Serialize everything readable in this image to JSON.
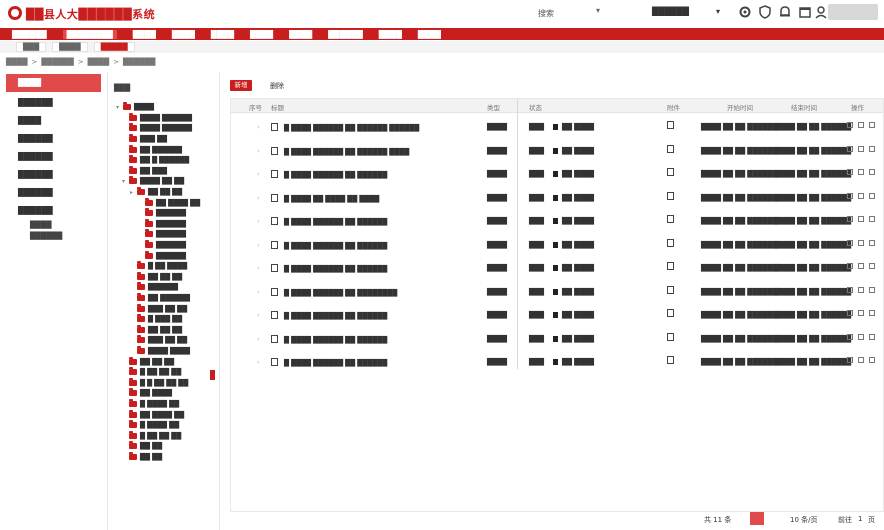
{
  "app": {
    "title": "██县人大██████系统",
    "search_label": "搜索",
    "user_name": "██████",
    "colors": {
      "brand": "#c81e1e",
      "brand_light": "#e04a4a",
      "header_bg": "#f2f2f2"
    },
    "toolbar_icons": [
      "gear-icon",
      "shield-icon",
      "bell-icon",
      "window-icon",
      "user-icon"
    ]
  },
  "nav": {
    "items": [
      "██████",
      "████████",
      "████",
      "████",
      "████",
      "████",
      "████",
      "██████",
      "████",
      "████"
    ]
  },
  "tabs": {
    "items": [
      "███",
      "████",
      "█████"
    ]
  },
  "breadcrumb": {
    "items": [
      "████",
      ">",
      "██████",
      ">",
      "████",
      ">",
      "██████"
    ]
  },
  "left_menu": {
    "items": [
      "████",
      "██████",
      "████",
      "██████",
      "██████",
      "██████",
      "██████",
      "██████"
    ],
    "sub_items": [
      "████",
      "██████"
    ]
  },
  "tree": {
    "label": "███",
    "nodes": [
      {
        "label": "████",
        "toggle": "▾"
      },
      {
        "label": "████ ██████",
        "toggle": ""
      },
      {
        "label": "████ ██████",
        "toggle": ""
      },
      {
        "label": "███ ██",
        "toggle": ""
      },
      {
        "label": "██ ██████",
        "toggle": ""
      },
      {
        "label": "██ █ ██████",
        "toggle": ""
      },
      {
        "label": "██ ███",
        "toggle": ""
      },
      {
        "label": "████ ██ ██",
        "toggle": "▾"
      },
      {
        "label": "██ ██ ██",
        "toggle": "▸"
      },
      {
        "label": "██ ████ ██",
        "toggle": ""
      },
      {
        "label": "██████",
        "toggle": ""
      },
      {
        "label": "██████",
        "toggle": ""
      },
      {
        "label": "██████",
        "toggle": ""
      },
      {
        "label": "██████",
        "toggle": ""
      },
      {
        "label": "██████",
        "toggle": ""
      },
      {
        "label": "█ ██ ████",
        "toggle": ""
      },
      {
        "label": "██ ██ ██",
        "toggle": ""
      },
      {
        "label": "██████",
        "toggle": ""
      },
      {
        "label": "██ ██████",
        "toggle": ""
      },
      {
        "label": "███ ██ ██",
        "toggle": ""
      },
      {
        "label": "█ ███ ██",
        "toggle": ""
      },
      {
        "label": "██ ██ ██",
        "toggle": ""
      },
      {
        "label": "███ ██ ██",
        "toggle": ""
      },
      {
        "label": "████ ████",
        "toggle": ""
      },
      {
        "label": "██ ██ ██",
        "toggle": ""
      },
      {
        "label": "█ ██ ██ ██",
        "toggle": ""
      },
      {
        "label": "█ █ ██ ██ ██",
        "toggle": ""
      },
      {
        "label": "██ ████",
        "toggle": ""
      },
      {
        "label": "█ ████ ██",
        "toggle": ""
      },
      {
        "label": "██ ████ ██",
        "toggle": ""
      },
      {
        "label": "█ ████ ██",
        "toggle": ""
      },
      {
        "label": "█ ██ ██ ██",
        "toggle": ""
      },
      {
        "label": "██ ██",
        "toggle": ""
      },
      {
        "label": "██ ██",
        "toggle": ""
      }
    ]
  },
  "toolbar": {
    "add_label": "新增",
    "delete_label": "删除"
  },
  "table": {
    "headers": [
      "序号",
      "标题",
      "类型",
      "状态",
      "附件",
      "开始时间",
      "结束时间",
      "操作"
    ],
    "rows": [
      {
        "title": "█ ████ ██████ ██ ██████ ██████",
        "type": "████",
        "count": "███",
        "status": "██ ████",
        "start": "████ ██ ██ ██████",
        "end": "████ ██ ██ ██████"
      },
      {
        "title": "█ ████ ██████ ██ ██████ ████",
        "type": "████",
        "count": "███",
        "status": "██ ████",
        "start": "████ ██ ██ ██████",
        "end": "████ ██ ██ ██████"
      },
      {
        "title": "█ ████ ██████ ██ ██████",
        "type": "████",
        "count": "███",
        "status": "██ ████",
        "start": "████ ██ ██ ██████",
        "end": "████ ██ ██ ██████"
      },
      {
        "title": "█ ████ ██ ████ ██ ████",
        "type": "████",
        "count": "███",
        "status": "██ ████",
        "start": "████ ██ ██ ██████",
        "end": "████ ██ ██ ██████"
      },
      {
        "title": "█ ████ ██████ ██ ██████",
        "type": "████",
        "count": "███",
        "status": "██ ████",
        "start": "████ ██ ██ ██████",
        "end": "████ ██ ██ ██████"
      },
      {
        "title": "█ ████ ██████ ██ ██████",
        "type": "████",
        "count": "███",
        "status": "██ ████",
        "start": "████ ██ ██ ██████",
        "end": "████ ██ ██ ██████"
      },
      {
        "title": "█ ████ ██████ ██ ██████",
        "type": "████",
        "count": "███",
        "status": "██ ████",
        "start": "████ ██ ██ ██████",
        "end": "████ ██ ██ ██████"
      },
      {
        "title": "█ ████ ██████ ██ ████████",
        "type": "████",
        "count": "███",
        "status": "██ ████",
        "start": "████ ██ ██ ██████",
        "end": "████ ██ ██ ██████"
      },
      {
        "title": "█ ████ ██████ ██ ██████",
        "type": "████",
        "count": "███",
        "status": "██ ████",
        "start": "████ ██ ██ ██████",
        "end": "████ ██ ██ ██████"
      },
      {
        "title": "█ ████ ██████ ██ ██████",
        "type": "████",
        "count": "███",
        "status": "██ ████",
        "start": "████ ██ ██ ██████",
        "end": "████ ██ ██ ██████"
      },
      {
        "title": "█ ████ ██████ ██ ██████",
        "type": "████",
        "count": "███",
        "status": "██ ████",
        "start": "████ ██ ██ ██████",
        "end": "████ ██ ██ ██████"
      }
    ]
  },
  "pager": {
    "total": "共 11 条",
    "page_size": "10 条/页",
    "goto_label": "前往",
    "page_input": "1",
    "page_suffix": "页"
  }
}
